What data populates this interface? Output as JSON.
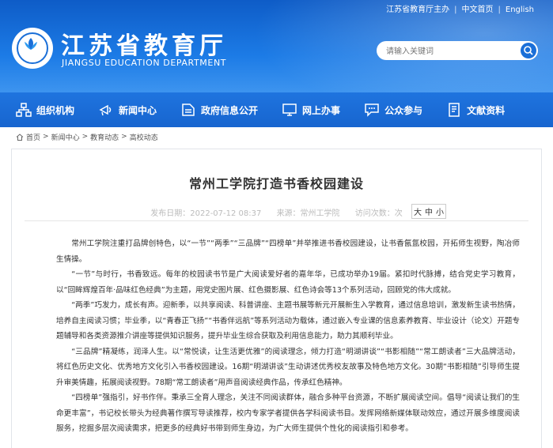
{
  "toplinks": {
    "sponsor": "江苏省教育厅主办",
    "chinese": "中文首页",
    "english": "English",
    "separator": "|"
  },
  "site": {
    "title": "江苏省教育厅",
    "subtitle": "JIANGSU EDUCATION DEPARTMENT"
  },
  "search": {
    "placeholder": "请输入关键词"
  },
  "nav": [
    {
      "label": "组织机构",
      "icon": "org-chart-icon"
    },
    {
      "label": "新闻中心",
      "icon": "news-icon"
    },
    {
      "label": "政府信息公开",
      "icon": "info-disclosure-icon"
    },
    {
      "label": "网上办事",
      "icon": "online-service-icon"
    },
    {
      "label": "公众参与",
      "icon": "public-participation-icon"
    },
    {
      "label": "文献资料",
      "icon": "documents-icon"
    }
  ],
  "breadcrumb": {
    "items": [
      "首页",
      "新闻中心",
      "教育动态",
      "高校动态"
    ],
    "separator": ">"
  },
  "article": {
    "title": "常州工学院打造书香校园建设",
    "published": "发布日期：2022-07-12 08:37",
    "source": "来源：常州工学院",
    "views": "访问次数：次",
    "font_sizes": {
      "large": "大",
      "medium": "中",
      "small": "小"
    },
    "paragraphs": [
      "常州工学院注重打品牌创特色，以“一节”“两季”“三品牌”“四榜单”并举推进书香校园建设，让书香氤氲校园，开拓师生视野，陶冶师生情操。",
      "“一节”与时行，书香致远。每年的校园读书节是广大阅读爱好者的嘉年华，已成功举办19届。紧扣时代脉搏，结合党史学习教育，以“回眸辉煌百年·品味红色经典”为主题，用党史图片展、红色摄影展、红色诗会等13个系列活动，回顾党的伟大成就。",
      "“两季”巧发力，成长有声。迎新季，以共享阅读、科普讲座、主题书展等新元开展新生入学教育，通过信息培训，激发新生读书热情，培养自主阅读习惯；毕业季，以“青春正飞扬”“书香伴远航”等系列活动为载体，通过嵌入专业课的信息素养教育、毕业设计（论文）开题专题辅导和各类资源推介讲座等提供知识服务，提升毕业生综合获取及利用信息能力，助力其顺利毕业。",
      "“三品牌”精凝练，润泽人生。以“常悦读，让生活更优雅”的阅读理念，倾力打造“明湖讲谈”“书影相随”“常工朗读者”三大品牌活动，将红色历史文化、优秀地方文化引入书香校园建设。16期“明湖讲谈”生动讲述优秀校友故事及特色地方文化。30期“书影相随”引导师生提升审美情趣，拓展阅读视野。78期“常工朗读者”用声音阅读经典作品，传承红色精神。",
      "“四榜单”强指引，好书作伴。秉承三全育人理念，关注不同阅读群体，融合多种平台资源，不断扩展阅读空间。倡导“阅读让我们的生命更丰富”，书记校长带头为经典著作撰写导读推荐，校内专家学者提供各学科阅读书目。发挥网络新媒体联动效应，通过开展多维度阅读服务，挖掘多层次阅读需求，把更多的经典好书带到师生身边，为广大师生提供个性化的阅读指引和参考。"
    ]
  }
}
